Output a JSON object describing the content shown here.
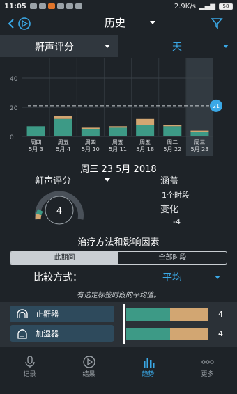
{
  "status": {
    "time": "11:05",
    "net": "2.9K/s",
    "battery": "58"
  },
  "header": {
    "title": "历史"
  },
  "selector": {
    "metric": "鼾声评分",
    "period": "天"
  },
  "chart_data": {
    "type": "bar",
    "categories": [
      "周四\n5月 3",
      "周五\n5月 4",
      "周四\n5月 10",
      "周五\n5月 11",
      "周五\n5月 18",
      "周二\n5月 22",
      "周三\n5月 23"
    ],
    "weekdays": [
      "周四",
      "周五",
      "周四",
      "周五",
      "周五",
      "周二",
      "周三"
    ],
    "dates": [
      "5月 3",
      "5月 4",
      "5月 10",
      "5月 11",
      "5月 18",
      "5月 22",
      "5月 23"
    ],
    "series": [
      {
        "values": [
          7,
          12,
          5,
          6,
          8,
          7,
          3
        ],
        "color": "#3d9a86"
      },
      {
        "values": [
          0,
          2,
          1,
          1,
          4,
          1,
          1
        ],
        "color": "#d2a672"
      }
    ],
    "ylim": [
      0,
      50
    ],
    "yticks": [
      0,
      20,
      40
    ],
    "average": {
      "value": 21,
      "label": "21"
    },
    "selected_index": 6
  },
  "detail": {
    "date": "周三 23 5月 2018",
    "metric": "鼾声评分",
    "score": "4",
    "coverage_title": "涵盖",
    "coverage_value": "1个时段",
    "change_title": "变化",
    "change_value": "-4"
  },
  "factors_section": {
    "title": "治疗方法和影响因素",
    "tabs": [
      "此期间",
      "全部时段"
    ],
    "compare_label": "比较方式：",
    "compare_value": "平均",
    "note": "有选定标签时段的平均值。",
    "rows": [
      {
        "label": "止鼾器",
        "icon": "mouthguard-icon",
        "value": "4",
        "green": 0.53,
        "tan": 0.47
      },
      {
        "label": "加湿器",
        "icon": "humidifier-icon",
        "value": "4",
        "green": 0.53,
        "tan": 0.47
      }
    ]
  },
  "nav": [
    {
      "label": "记录",
      "icon": "microphone-icon"
    },
    {
      "label": "结果",
      "icon": "play-circle-icon"
    },
    {
      "label": "趋势",
      "icon": "bar-chart-icon",
      "active": true
    },
    {
      "label": "更多",
      "icon": "more-dots-icon"
    }
  ]
}
